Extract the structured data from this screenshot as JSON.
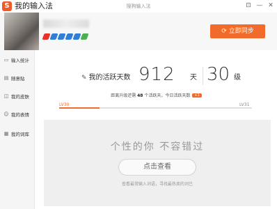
{
  "app": {
    "logo_glyph": "S",
    "title": "我的输入法",
    "center_title": "搜狗输入法"
  },
  "window_controls": {
    "feedback_glyph": "⊡",
    "minimize_glyph": "—",
    "close_glyph": "✕"
  },
  "header": {
    "badge_colors": [
      "#e5322d",
      "#2f7fd6",
      "#2f7fd6",
      "#2f7fd6",
      "#2f7fd6",
      "#4caf50"
    ],
    "sync_icon": "⟳",
    "sync_label": "立即同步",
    "accent": "#f26b2a"
  },
  "sidebar": {
    "items": [
      {
        "icon": "chart-icon",
        "glyph": "▭",
        "label": "输入统计"
      },
      {
        "icon": "note-icon",
        "glyph": "▤",
        "label": "随意贴"
      },
      {
        "icon": "skin-icon",
        "glyph": "◫",
        "label": "我的皮肤"
      },
      {
        "icon": "emoji-icon",
        "glyph": "☺",
        "label": "我的表情"
      },
      {
        "icon": "dict-icon",
        "glyph": "▦",
        "label": "我的词库"
      }
    ]
  },
  "stats": {
    "icon": "edit-icon",
    "icon_glyph": "✎",
    "label": "我的活跃天数",
    "days": "912",
    "days_unit": "天",
    "level": "30",
    "level_unit": "级"
  },
  "progress": {
    "prefix": "距离升级还需",
    "remaining": "48",
    "middle": "个活跃天，今日活跃天数",
    "today_badge": "+1",
    "level_from": "LV30",
    "level_to": "LV31",
    "fraction": 0.21
  },
  "promo": {
    "title": "个性的你  不容错过",
    "button_label": "点击查看",
    "note": "查看最常输入词语，寻找最热卖的词已"
  }
}
